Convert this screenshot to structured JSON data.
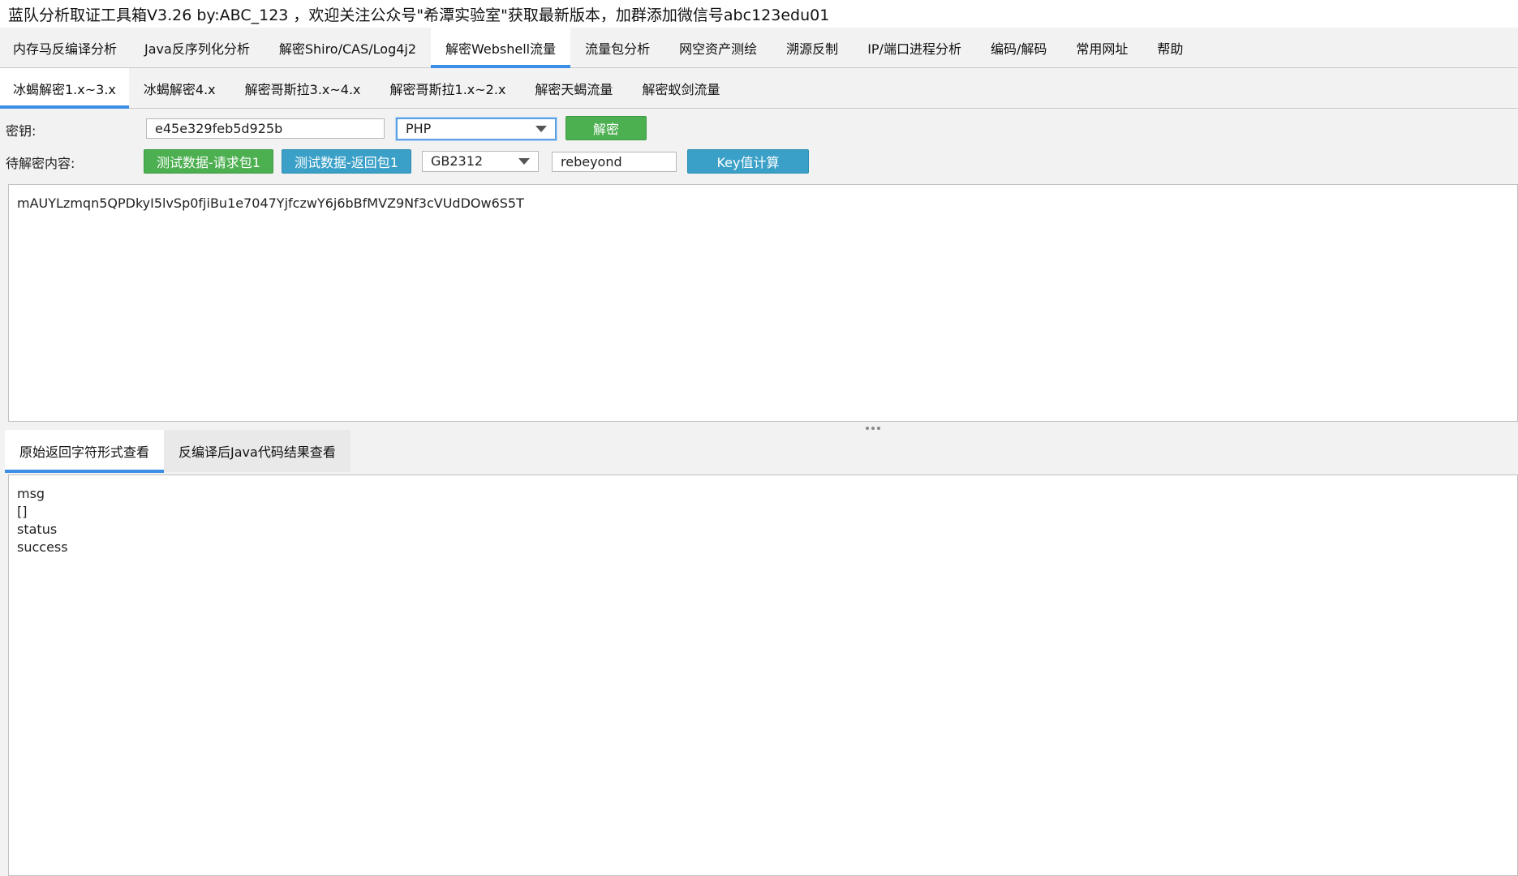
{
  "window": {
    "title": "蓝队分析取证工具箱V3.26 by:ABC_123 ，欢迎关注公众号\"希潭实验室\"获取最新版本，加群添加微信号abc123edu01"
  },
  "main_tabs": [
    {
      "label": "内存马反编译分析",
      "active": false
    },
    {
      "label": "Java反序列化分析",
      "active": false
    },
    {
      "label": "解密Shiro/CAS/Log4j2",
      "active": false
    },
    {
      "label": "解密Webshell流量",
      "active": true
    },
    {
      "label": "流量包分析",
      "active": false
    },
    {
      "label": "网空资产测绘",
      "active": false
    },
    {
      "label": "溯源反制",
      "active": false
    },
    {
      "label": "IP/端口进程分析",
      "active": false
    },
    {
      "label": "编码/解码",
      "active": false
    },
    {
      "label": "常用网址",
      "active": false
    },
    {
      "label": "帮助",
      "active": false
    }
  ],
  "sub_tabs": [
    {
      "label": "冰蝎解密1.x~3.x",
      "active": true
    },
    {
      "label": "冰蝎解密4.x",
      "active": false
    },
    {
      "label": "解密哥斯拉3.x~4.x",
      "active": false
    },
    {
      "label": "解密哥斯拉1.x~2.x",
      "active": false
    },
    {
      "label": "解密天蝎流量",
      "active": false
    },
    {
      "label": "解密蚁剑流量",
      "active": false
    }
  ],
  "form": {
    "key_label": "密钥:",
    "key_value": "e45e329feb5d925b",
    "language_selected": "PHP",
    "decrypt_button": "解密",
    "content_label": "待解密内容:",
    "test_request_button": "测试数据-请求包1",
    "test_response_button": "测试数据-返回包1",
    "encoding_selected": "GB2312",
    "password_value": "rebeyond",
    "key_calc_button": "Key值计算"
  },
  "input_text": "mAUYLzmqn5QPDkyI5lvSp0fjiBu1e7047YjfczwY6j6bBfMVZ9Nf3cVUdDOw6S5T",
  "result_tabs": [
    {
      "label": "原始返回字符形式查看",
      "active": true
    },
    {
      "label": "反编译后Java代码结果查看",
      "active": false
    }
  ],
  "output_lines": "msg\n[]\nstatus\nsuccess",
  "colors": {
    "accent": "#3a8ee6",
    "green_button": "#4caf50",
    "blue_button": "#3aa0c7"
  }
}
